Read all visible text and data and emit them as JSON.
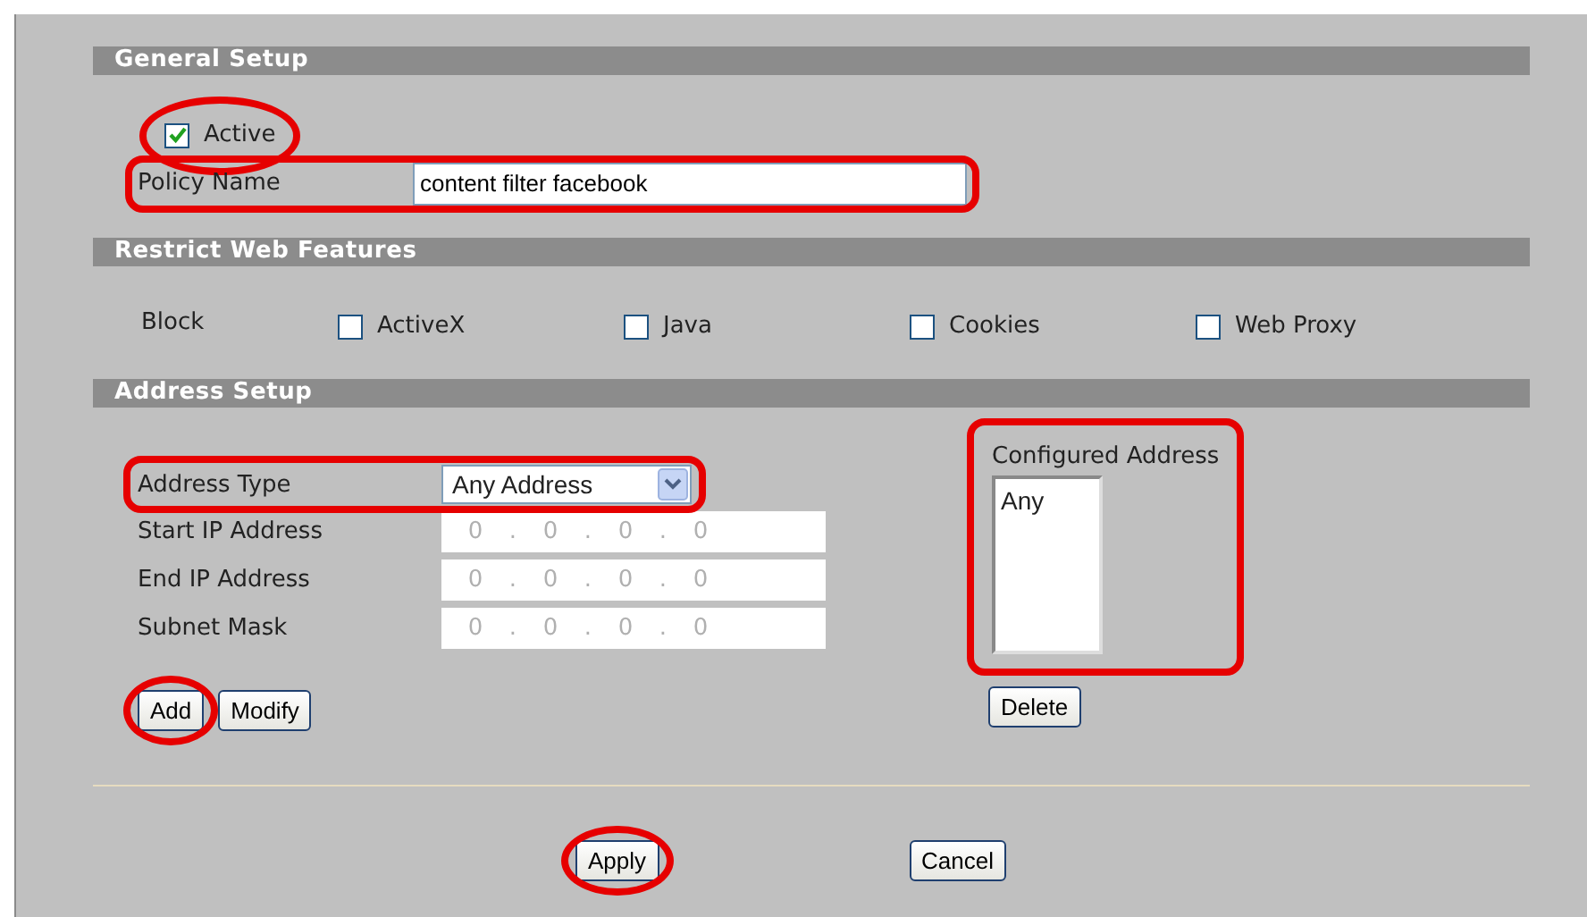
{
  "general_setup": {
    "title": "General Setup",
    "active": {
      "label": "Active",
      "checked": true,
      "circled": true
    },
    "policy_name": {
      "label": "Policy Name",
      "value": "content filter facebook",
      "boxed": true
    }
  },
  "restrict_web_features": {
    "title": "Restrict Web Features",
    "label": "Block",
    "options": [
      {
        "label": "ActiveX",
        "checked": false
      },
      {
        "label": "Java",
        "checked": false
      },
      {
        "label": "Cookies",
        "checked": false
      },
      {
        "label": "Web Proxy",
        "checked": false
      }
    ]
  },
  "address_setup": {
    "title": "Address Setup",
    "address_type": {
      "label": "Address Type",
      "value": "Any Address",
      "boxed": true
    },
    "ip_fields": [
      {
        "label": "Start IP Address",
        "octets": [
          "0",
          "0",
          "0",
          "0"
        ],
        "separator": ".",
        "disabled": true
      },
      {
        "label": "End IP Address",
        "octets": [
          "0",
          "0",
          "0",
          "0"
        ],
        "separator": ".",
        "disabled": true
      },
      {
        "label": "Subnet Mask",
        "octets": [
          "0",
          "0",
          "0",
          "0"
        ],
        "separator": ".",
        "disabled": true
      }
    ],
    "buttons": [
      {
        "label": "Add",
        "circled": true
      },
      {
        "label": "Modify"
      }
    ],
    "configured": {
      "label": "Configured Address",
      "items": [
        "Any"
      ],
      "boxed": true,
      "buttons": [
        {
          "label": "Delete"
        }
      ]
    }
  },
  "buttons": [
    {
      "label": "Apply",
      "circled": true
    },
    {
      "label": "Cancel"
    }
  ]
}
